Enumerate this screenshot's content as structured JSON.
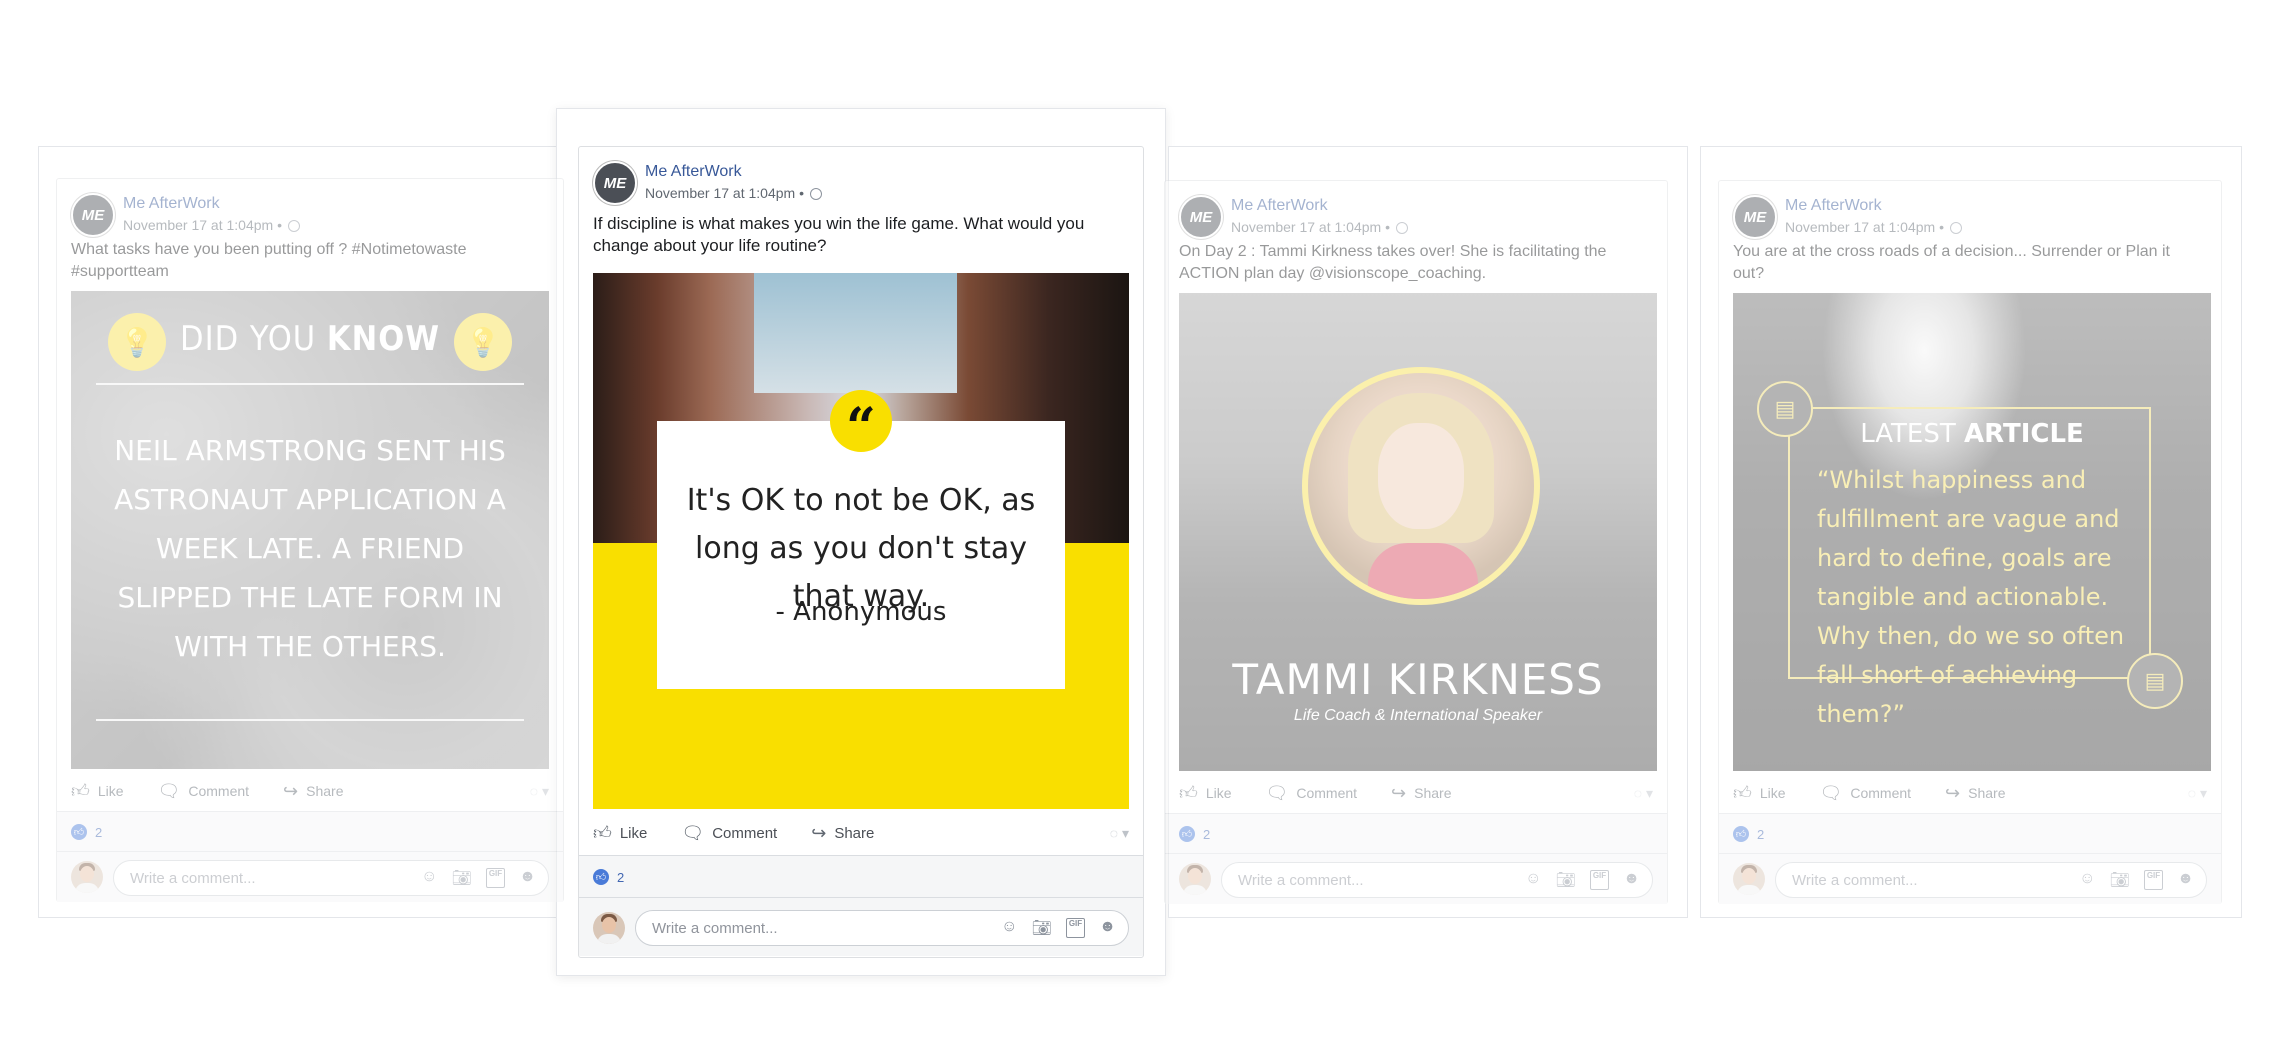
{
  "posts": [
    {
      "author": "Me AfterWork",
      "timestamp": "November 17 at 1:04pm •",
      "text": "What tasks have you been putting off ? #Notimetowaste #supportteam",
      "image": {
        "title_light": "DID YOU",
        "title_bold": "KNOW",
        "body": "NEIL ARMSTRONG SENT HIS ASTRONAUT APPLICATION A WEEK LATE. A FRIEND SLIPPED THE LATE FORM IN WITH THE OTHERS."
      },
      "actions": {
        "like": "Like",
        "comment": "Comment",
        "share": "Share"
      },
      "reaction_count": "2",
      "comment_placeholder": "Write a comment..."
    },
    {
      "author": "Me AfterWork",
      "timestamp": "November 17 at 1:04pm •",
      "text": "If discipline is what makes you win the life game. What would you change about your life routine?",
      "image": {
        "quote": "It's OK to not be OK, as long as you don't stay that way.",
        "quote_author": "- Anonymous",
        "quote_mark": "“"
      },
      "actions": {
        "like": "Like",
        "comment": "Comment",
        "share": "Share"
      },
      "reaction_count": "2",
      "comment_placeholder": "Write a comment..."
    },
    {
      "author": "Me AfterWork",
      "timestamp": "November 17 at 1:04pm •",
      "text": "On Day 2 : Tammi Kirkness takes over! She is facilitating the ACTION plan day @visionscope_coaching.",
      "image": {
        "name": "TAMMI KIRKNESS",
        "role": "Life Coach & International Speaker"
      },
      "actions": {
        "like": "Like",
        "comment": "Comment",
        "share": "Share"
      },
      "reaction_count": "2",
      "comment_placeholder": "Write a comment..."
    },
    {
      "author": "Me AfterWork",
      "timestamp": "November 17 at 1:04pm •",
      "text": "You are at the cross roads of a decision... Surrender or Plan it out?",
      "image": {
        "title_light": "LATEST",
        "title_bold": "ARTICLE",
        "quote": "“Whilst happiness and fulfillment are vague and hard to define, goals are tangible and actionable. Why then, do we so often fall short of achieving them?”"
      },
      "actions": {
        "like": "Like",
        "comment": "Comment",
        "share": "Share"
      },
      "reaction_count": "2",
      "comment_placeholder": "Write a comment..."
    }
  ],
  "avatar_text": "ME",
  "colors": {
    "accent_yellow": "#f9df00",
    "link_blue": "#385898",
    "like_blue": "#4a7bd8"
  },
  "icons": [
    "thumbs-up-icon",
    "comment-icon",
    "share-icon",
    "globe-icon",
    "smiley-icon",
    "camera-icon",
    "gif-icon",
    "sticker-icon",
    "lightbulb-icon",
    "article-icon"
  ]
}
